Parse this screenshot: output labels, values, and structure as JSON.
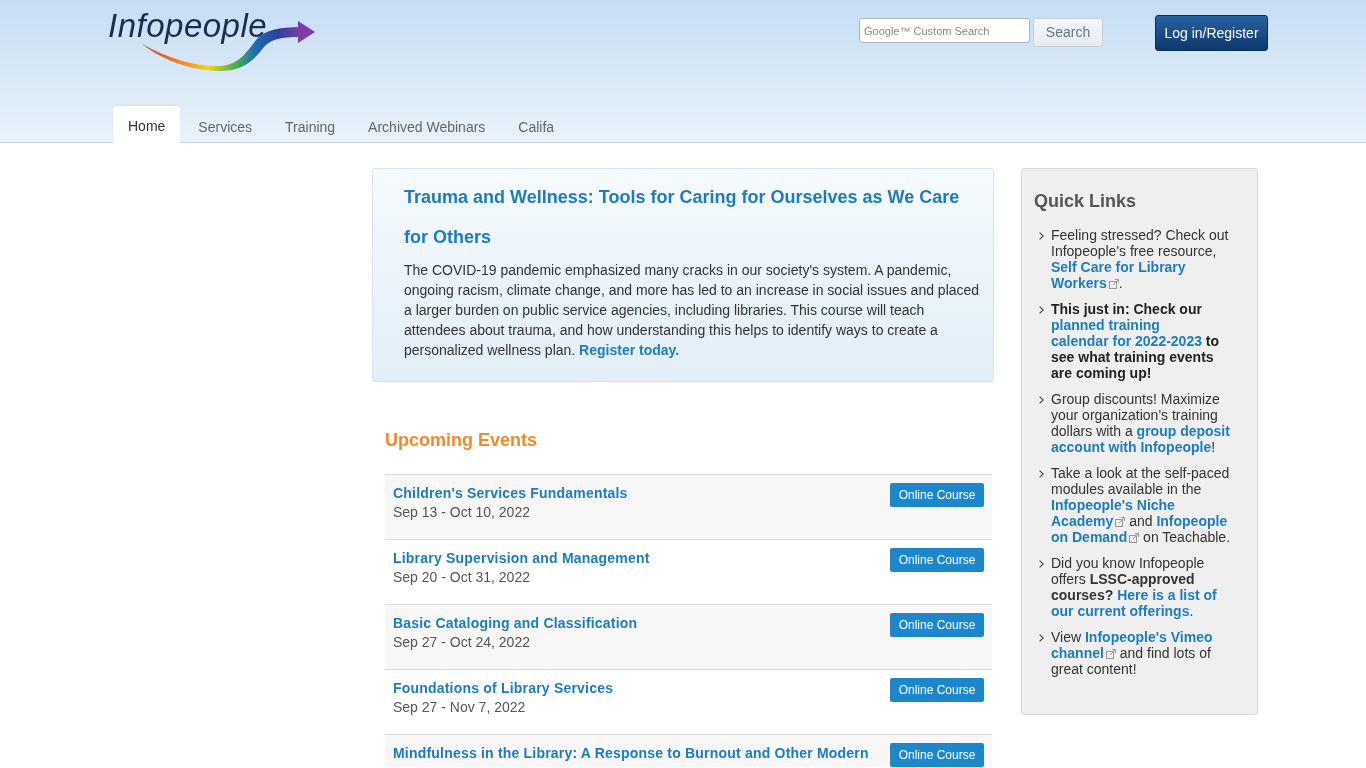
{
  "header": {
    "logo": "Infopeople",
    "search": {
      "placeholder": "Google™ Custom Search",
      "button": "Search"
    },
    "login_button": "Log in/Register"
  },
  "nav": {
    "tabs": [
      {
        "label": "Home",
        "selected": true
      },
      {
        "label": "Services",
        "selected": false
      },
      {
        "label": "Training",
        "selected": false
      },
      {
        "label": "Archived Webinars",
        "selected": false
      },
      {
        "label": "Califa",
        "selected": false
      }
    ]
  },
  "feature": {
    "title": "Trauma and Wellness: Tools for Caring for Ourselves as We Care for Others",
    "body": "The COVID-19 pandemic emphasized many cracks in our society's system. A pandemic, ongoing racism, climate change, and more has led to an increase in social issues and placed a larger burden on public service agencies, including libraries. This course will teach attendees about trauma, and how understanding this helps to identify ways to create a personalized wellness plan.",
    "link": "Register today."
  },
  "upcoming_events": {
    "title": "Upcoming Events",
    "events": [
      {
        "title": "Children's Services Fundamentals",
        "dates": "Sep 13 - Oct 10, 2022",
        "format": "Online Course"
      },
      {
        "title": "Library Supervision and Management",
        "dates": "Sep 20 - Oct 31, 2022",
        "format": "Online Course"
      },
      {
        "title": "Basic Cataloging and Classification",
        "dates": "Sep 27 - Oct 24, 2022",
        "format": "Online Course"
      },
      {
        "title": "Foundations of Library Services",
        "dates": "Sep 27 - Nov 7, 2022",
        "format": "Online Course"
      },
      {
        "title": "Mindfulness in the Library: A Response to Burnout and Other Modern",
        "format": "Online Course"
      }
    ]
  },
  "quick_links": {
    "title": "Quick Links",
    "items": [
      {
        "bold": false,
        "parts": [
          {
            "kind": "text",
            "text": "Feeling stressed? Check out Infopeople's free resource, "
          },
          {
            "kind": "link",
            "text": "Self Care for Library",
            "external": false
          },
          {
            "kind": "link",
            "text": "Workers",
            "external": true
          },
          {
            "kind": "text",
            "text": "."
          }
        ]
      },
      {
        "bold": true,
        "parts": [
          {
            "kind": "text",
            "text": "This just in: Check our "
          },
          {
            "kind": "link",
            "text": "planned training",
            "external": false
          },
          {
            "kind": "link",
            "text": "calendar for 2022-2023",
            "external": false
          },
          {
            "kind": "text",
            "text": " to see what training events are coming up!"
          }
        ]
      },
      {
        "bold": false,
        "parts": [
          {
            "kind": "text",
            "text": "Group discounts! Maximize your organization's training dollars with a "
          },
          {
            "kind": "link",
            "text": "group deposit",
            "external": false
          },
          {
            "kind": "link",
            "text": "account with Infopeople",
            "external": false
          },
          {
            "kind": "text",
            "text": "!"
          }
        ]
      },
      {
        "bold": false,
        "parts": [
          {
            "kind": "text",
            "text": "Take a look at the self-paced modules available in the "
          },
          {
            "kind": "link",
            "text": "Infopeople's Niche",
            "external": false
          },
          {
            "kind": "link",
            "text": "Academy",
            "external": true
          },
          {
            "kind": "text",
            "text": " and "
          },
          {
            "kind": "link",
            "text": "Infopeople",
            "external": false
          },
          {
            "kind": "link",
            "text": "on Demand",
            "external": true
          },
          {
            "kind": "text",
            "text": " on Teachable."
          }
        ]
      },
      {
        "bold": false,
        "parts": [
          {
            "kind": "text",
            "text": "Did you know Infopeople offers **LSSC-approved courses?** "
          },
          {
            "kind": "link",
            "text": "Here is a list of",
            "external": false
          },
          {
            "kind": "link",
            "text": "our current offerings",
            "external": false
          },
          {
            "kind": "text",
            "text": "."
          }
        ]
      },
      {
        "bold": false,
        "parts": [
          {
            "kind": "text",
            "text": "View "
          },
          {
            "kind": "link",
            "text": "Infopeople's Vimeo",
            "external": false
          },
          {
            "kind": "link",
            "text": "channel",
            "external": true
          },
          {
            "kind": "text",
            "text": " and find lots of great content!"
          }
        ]
      }
    ]
  }
}
